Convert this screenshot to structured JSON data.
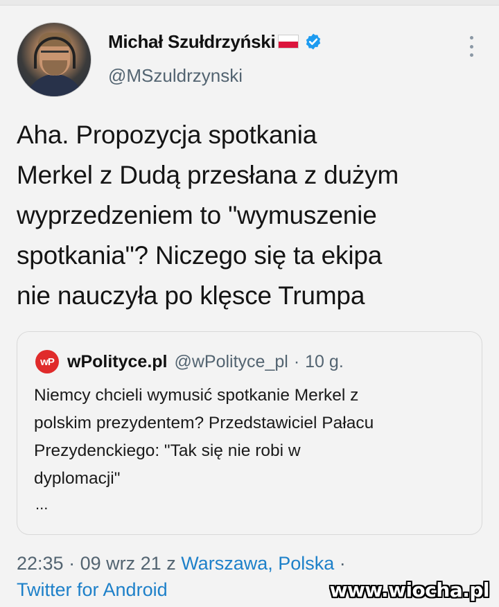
{
  "author": {
    "display_name": "Michał Szułdrzyński",
    "handle": "@MSzuldrzynski",
    "flag_icon": "poland-flag-icon",
    "verified_icon": "verified-badge-icon",
    "verified_color": "#1d9bf0"
  },
  "tweet": {
    "lines": [
      "Aha. Propozycja spotkania",
      "Merkel z Dudą przesłana z dużym",
      "wyprzedzeniem to \"wymuszenie",
      "spotkania\"? Niczego się ta ekipa",
      "nie nauczyła po klęsce Trumpa"
    ]
  },
  "quote": {
    "logo_text": "wP",
    "name": "wPolityce.pl",
    "handle": "@wPolityce_pl",
    "separator": "·",
    "time": "10 g.",
    "lines": [
      "Niemcy chcieli wymusić spotkanie Merkel z",
      "polskim prezydentem? Przedstawiciel Pałacu",
      "Prezydenckiego: \"Tak się nie robi w",
      "dyplomacji\""
    ],
    "ellipsis": "..."
  },
  "meta": {
    "time": "22:35",
    "sep1": "·",
    "date": "09 wrz 21",
    "from": "z",
    "location": "Warszawa, Polska",
    "sep2": "·",
    "source": "Twitter for Android"
  },
  "watermark": "www.wiocha.pl",
  "colors": {
    "link": "#1d80c9",
    "secondary_text": "#536471",
    "logo_red": "#e02b2b"
  }
}
